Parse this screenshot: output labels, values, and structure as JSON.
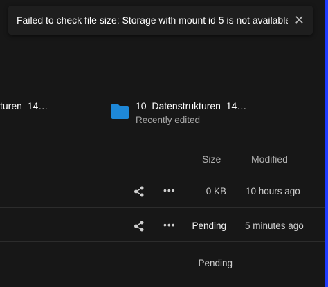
{
  "toast": {
    "message": "Failed to check file size: Storage with mount id 5 is not available",
    "close_icon": "close-icon"
  },
  "recent": [
    {
      "title": "turen_14…",
      "icon": "folder-icon"
    },
    {
      "title": "10_Datenstrukturen_14…",
      "subtitle": "Recently edited",
      "icon": "folder-icon"
    }
  ],
  "table": {
    "headers": {
      "size": "Size",
      "modified": "Modified"
    },
    "rows": [
      {
        "size": "0 KB",
        "modified": "10 hours ago",
        "actions": [
          "share-icon",
          "more-icon"
        ]
      },
      {
        "size": "Pending",
        "modified": "5 minutes ago",
        "actions": [
          "share-icon",
          "more-icon"
        ]
      },
      {
        "size": "Pending",
        "modified": ""
      }
    ]
  },
  "colors": {
    "background": "#171717",
    "folder": "#1e88d8",
    "accent_edge": "#1f3cff"
  }
}
